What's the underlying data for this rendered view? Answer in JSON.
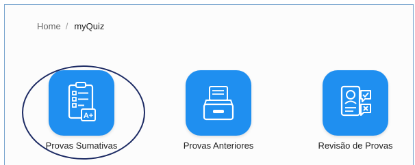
{
  "breadcrumb": {
    "home": "Home",
    "separator": "/",
    "current": "myQuiz"
  },
  "tiles": [
    {
      "label": "Provas Sumativas",
      "icon": "graded-test-icon",
      "highlighted": true
    },
    {
      "label": "Provas Anteriores",
      "icon": "file-archive-icon",
      "highlighted": false
    },
    {
      "label": "Revisão de Provas",
      "icon": "review-profile-icon",
      "highlighted": false
    }
  ],
  "colors": {
    "tile": "#1f8ff0",
    "highlight": "#1d2b64",
    "border": "#7ba6cf"
  }
}
